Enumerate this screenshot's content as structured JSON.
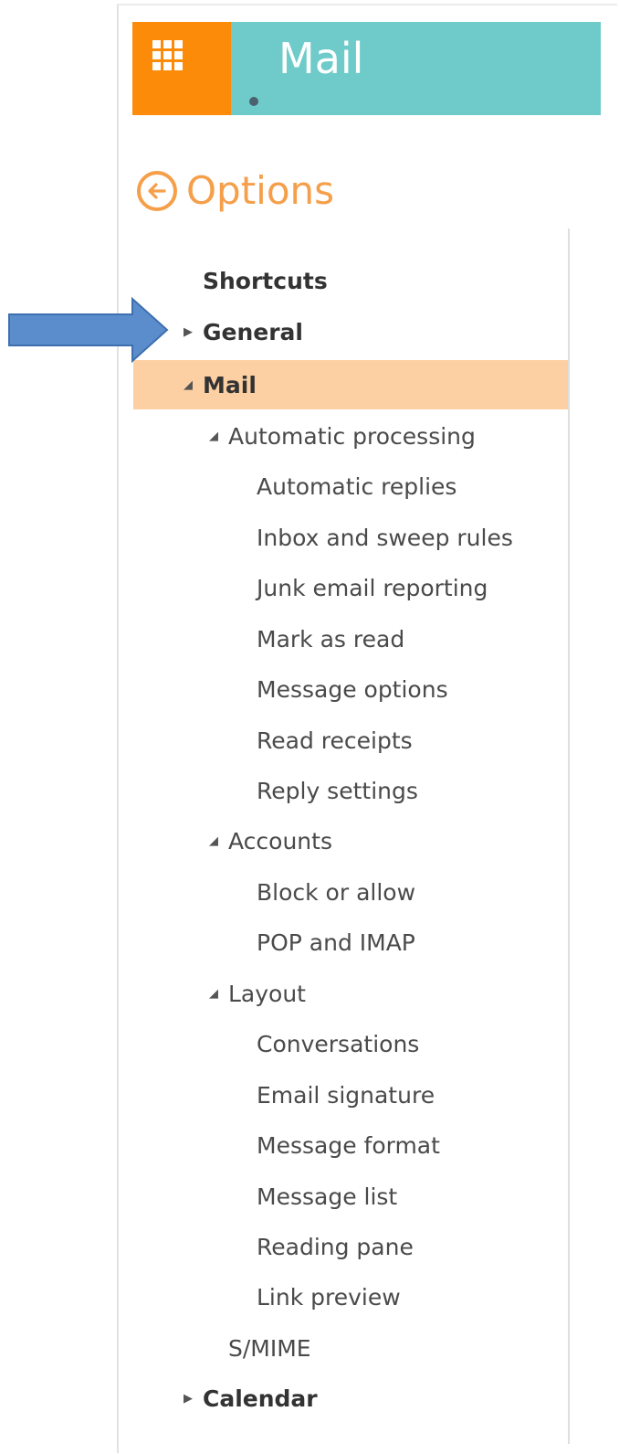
{
  "header": {
    "app_title": "Mail"
  },
  "options": {
    "title": "Options"
  },
  "nav": {
    "shortcuts": "Shortcuts",
    "general": "General",
    "mail": "Mail",
    "automatic_processing": "Automatic processing",
    "automatic_replies": "Automatic replies",
    "inbox_sweep_rules": "Inbox and sweep rules",
    "junk_email_reporting": "Junk email reporting",
    "mark_as_read": "Mark as read",
    "message_options": "Message options",
    "read_receipts": "Read receipts",
    "reply_settings": "Reply settings",
    "accounts": "Accounts",
    "block_or_allow": "Block or allow",
    "pop_imap": "POP and IMAP",
    "layout": "Layout",
    "conversations": "Conversations",
    "email_signature": "Email signature",
    "message_format": "Message format",
    "message_list": "Message list",
    "reading_pane": "Reading pane",
    "link_preview": "Link preview",
    "smime": "S/MIME",
    "calendar": "Calendar"
  },
  "colors": {
    "header_bg": "#6ecbca",
    "launcher_bg": "#fb8b08",
    "accent_orange": "#f59f4a",
    "selected_bg": "#fdd0a4",
    "callout_arrow": "#5b8ccc"
  },
  "icons": {
    "launcher": "app-launcher-waffle-icon",
    "back": "back-arrow-circle-icon",
    "expanded": "caret-down-icon",
    "collapsed": "caret-right-icon",
    "callout": "callout-arrow-icon"
  }
}
